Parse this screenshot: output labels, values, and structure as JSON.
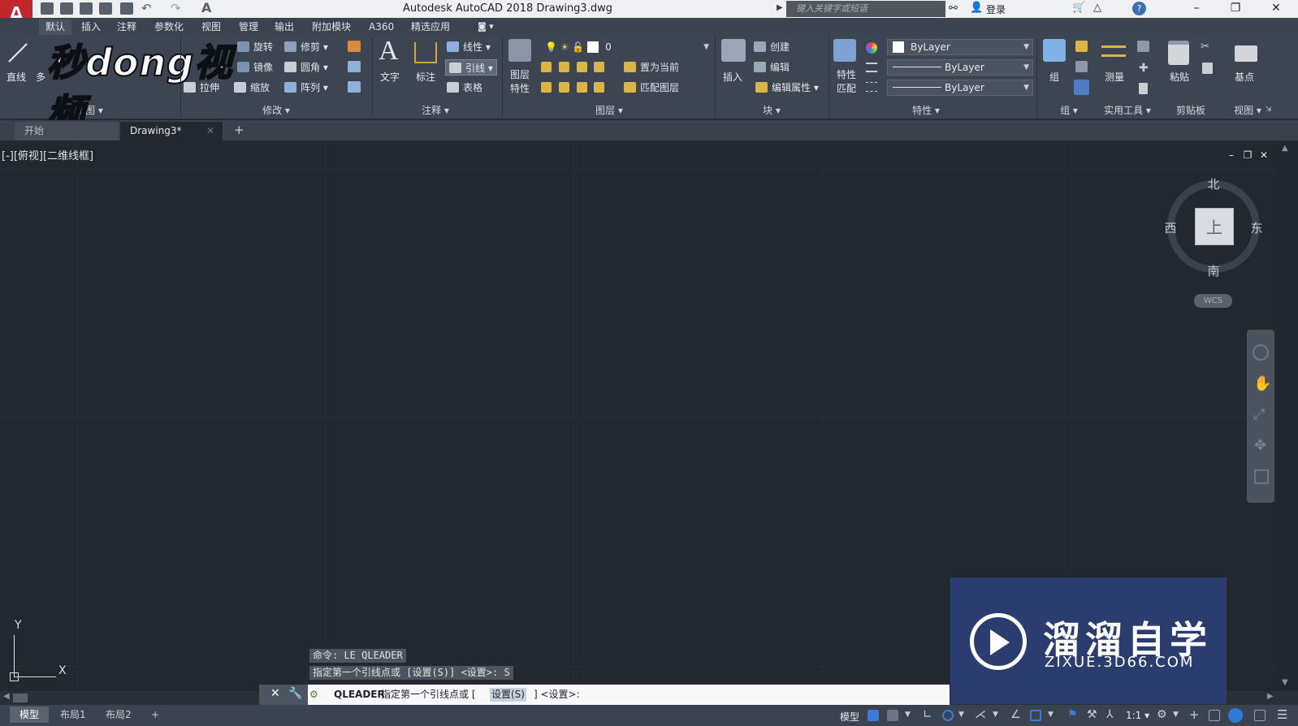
{
  "window": {
    "title": "Autodesk AutoCAD 2018    Drawing3.dwg",
    "app_icon": "autocad-a-icon",
    "search_placeholder": "键入关键字或短语",
    "login": "登录",
    "help": "?"
  },
  "ribbon_tabs": [
    "默认",
    "插入",
    "注释",
    "参数化",
    "视图",
    "管理",
    "输出",
    "附加模块",
    "A360",
    "精选应用"
  ],
  "ribbon": {
    "draw": {
      "line": "直线",
      "polyline": "多",
      "label": "绘图"
    },
    "modify": {
      "rotate": "旋转",
      "trim": "修剪",
      "mirror": "镜像",
      "fillet": "圆角",
      "stretch": "拉伸",
      "scale": "缩放",
      "array": "阵列",
      "label": "修改"
    },
    "annotation": {
      "text": "文字",
      "dimension": "标注",
      "linear": "线性",
      "leader": "引线",
      "table": "表格",
      "label": "注释"
    },
    "layers": {
      "layer_properties_1": "图层",
      "layer_properties_2": "特性",
      "current_layer": "0",
      "make_current": "置为当前",
      "match_layer": "匹配图层",
      "label": "图层"
    },
    "block": {
      "insert": "插入",
      "create": "创建",
      "edit": "编辑",
      "edit_attributes": "编辑属性",
      "label": "块"
    },
    "properties": {
      "match_1": "特性",
      "match_2": "匹配",
      "color": "ByLayer",
      "linetype": "ByLayer",
      "lineweight": "ByLayer",
      "label": "特性"
    },
    "groups": {
      "group": "组",
      "label": "组"
    },
    "utilities": {
      "measure": "测量",
      "label": "实用工具"
    },
    "clipboard": {
      "paste": "粘贴",
      "label": "剪贴板"
    },
    "view": {
      "base": "基点",
      "label": "视图"
    }
  },
  "watermark_top": "秒dong视频",
  "file_tabs": {
    "start": "开始",
    "drawing": "Drawing3*",
    "new": "+"
  },
  "viewport": {
    "label": "[-][俯视][二维线框]",
    "controls": [
      "–",
      "❐",
      "✕"
    ]
  },
  "viewcube": {
    "north": "北",
    "south": "南",
    "east": "东",
    "west": "西",
    "face": "上",
    "wcs": "WCS"
  },
  "ucs": {
    "x": "X",
    "y": "Y"
  },
  "command_history": [
    "命令: LE QLEADER",
    "指定第一个引线点或 [设置(S)] <设置>: S"
  ],
  "command_line": {
    "command": "QLEADER",
    "prompt": "指定第一个引线点或 [",
    "option": "设置(S)",
    "suffix": "] <设置>:"
  },
  "layout_tabs": [
    "模型",
    "布局1",
    "布局2",
    "+"
  ],
  "status": {
    "model": "模型",
    "scale": "1:1"
  },
  "watermark_bottom": {
    "title": "溜溜自学",
    "subtitle": "ZIXUE.3D66.COM"
  },
  "colors": {
    "ribbon": "#3d4553",
    "canvas": "#212830",
    "watermark": "#2a3d6e",
    "accent_red": "#d3262b",
    "accent_blue": "#2e7bd6"
  }
}
